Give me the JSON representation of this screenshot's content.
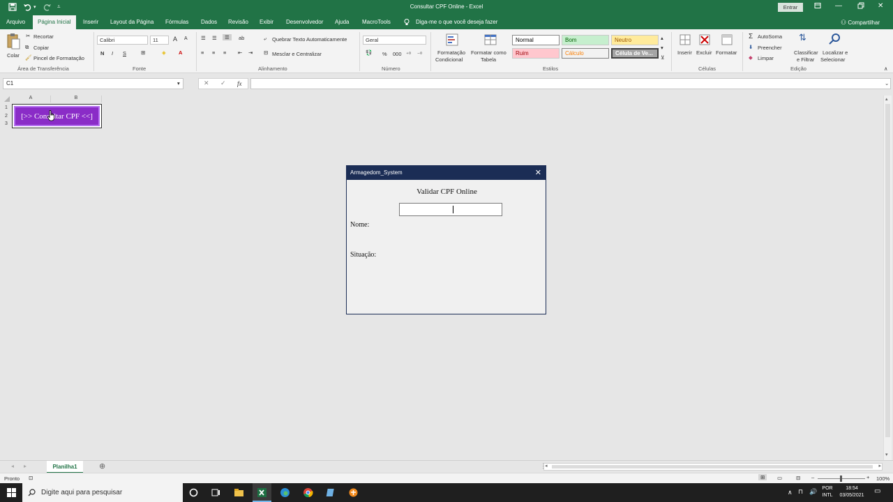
{
  "titlebar": {
    "title": "Consultar CPF Online  -  Excel",
    "signin": "Entrar",
    "share": "Compartilhar"
  },
  "tabs": [
    "Arquivo",
    "Página Inicial",
    "Inserir",
    "Layout da Página",
    "Fórmulas",
    "Dados",
    "Revisão",
    "Exibir",
    "Desenvolvedor",
    "Ajuda",
    "MacroTools"
  ],
  "tell_me": "Diga-me o que você deseja fazer",
  "ribbon": {
    "clipboard": {
      "paste": "Colar",
      "cut": "Recortar",
      "copy": "Copiar",
      "format_painter": "Pincel de Formatação",
      "group": "Área de Transferência"
    },
    "font": {
      "name": "Calibri",
      "size": "11",
      "bold": "N",
      "italic": "I",
      "underline": "S",
      "group": "Fonte"
    },
    "alignment": {
      "wrap": "Quebrar Texto Automaticamente",
      "merge": "Mesclar e Centralizar",
      "group": "Alinhamento"
    },
    "number": {
      "format": "Geral",
      "percent": "%",
      "thousands": "000",
      "group": "Número"
    },
    "styles": {
      "cond_format": [
        "Formatação",
        "Condicional"
      ],
      "format_table": [
        "Formatar como",
        "Tabela"
      ],
      "cells": [
        {
          "label": "Normal",
          "bg": "#ffffff",
          "fg": "#000000"
        },
        {
          "label": "Bom",
          "bg": "#c6efce",
          "fg": "#006100"
        },
        {
          "label": "Neutro",
          "bg": "#ffeb9c",
          "fg": "#9c5700"
        },
        {
          "label": "Ruim",
          "bg": "#ffc7ce",
          "fg": "#9c0006"
        },
        {
          "label": "Cálculo",
          "bg": "#f2f2f2",
          "fg": "#fa7d00"
        },
        {
          "label": "Célula de Ve...",
          "bg": "#a5a5a5",
          "fg": "#ffffff"
        }
      ],
      "group": "Estilos"
    },
    "cells": {
      "insert": "Inserir",
      "delete": "Excluir",
      "format": "Formatar",
      "group": "Células"
    },
    "editing": {
      "autosum": "AutoSoma",
      "fill": "Preencher",
      "clear": "Limpar",
      "sort": [
        "Classificar",
        "e Filtrar"
      ],
      "find": [
        "Localizar e",
        "Selecionar"
      ],
      "group": "Edição"
    }
  },
  "formula_bar": {
    "name_box": "C1",
    "fx": "fx",
    "formula": ""
  },
  "grid": {
    "columns": [
      "A",
      "B"
    ],
    "rows": [
      "1",
      "2",
      "3"
    ],
    "macro_button": "[>> Consultar CPF <<]"
  },
  "dialog": {
    "title": "Armagedom_System",
    "close": "✕",
    "heading": "Validar CPF Online",
    "cpf_value": "",
    "name_label": "Nome:",
    "status_label": "Situação:"
  },
  "sheets": [
    "Planilha1"
  ],
  "status": {
    "ready": "Pronto",
    "zoom": "100%"
  },
  "taskbar": {
    "search": "Digite aqui para pesquisar",
    "lang": [
      "POR",
      "INTL"
    ],
    "time": "18:54",
    "date": "03/05/2021"
  },
  "colors": {
    "excel_green": "#217346",
    "dialog_title": "#1b2d55",
    "macro_purple": "#8a2cc7"
  }
}
